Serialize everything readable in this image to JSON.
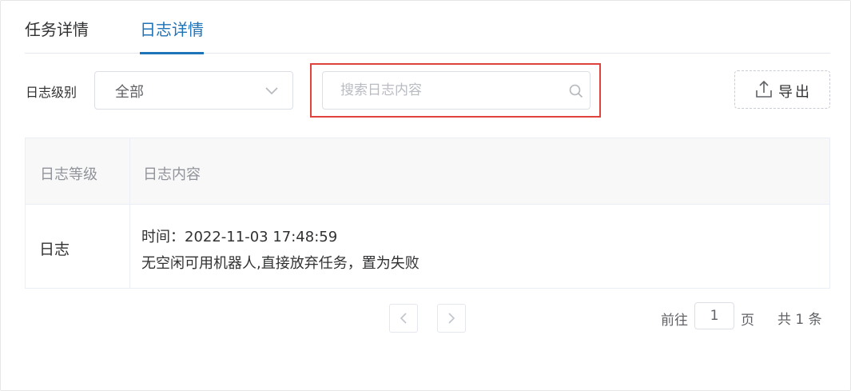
{
  "tabs": [
    {
      "label": "任务详情",
      "active": false
    },
    {
      "label": "日志详情",
      "active": true
    }
  ],
  "filter": {
    "level_label": "日志级别",
    "level_selected": "全部",
    "search_placeholder": "搜索日志内容",
    "search_value": "",
    "export_label": "导出"
  },
  "table": {
    "headers": [
      "日志等级",
      "日志内容"
    ],
    "rows": [
      {
        "level": "日志",
        "time_line": "时间：2022-11-03 17:48:59",
        "message": "无空闲可用机器人,直接放弃任务，置为失败"
      }
    ]
  },
  "pagination": {
    "goto_label": "前往",
    "current_page": "1",
    "page_suffix": "页",
    "total_text": "共 1 条"
  },
  "colors": {
    "accent": "#1f73b7",
    "highlight": "#e0423c"
  },
  "icons": {
    "select_arrow": "chevron-down-icon",
    "search": "search-icon",
    "export": "upload-icon",
    "prev": "chevron-left-icon",
    "next": "chevron-right-icon"
  }
}
